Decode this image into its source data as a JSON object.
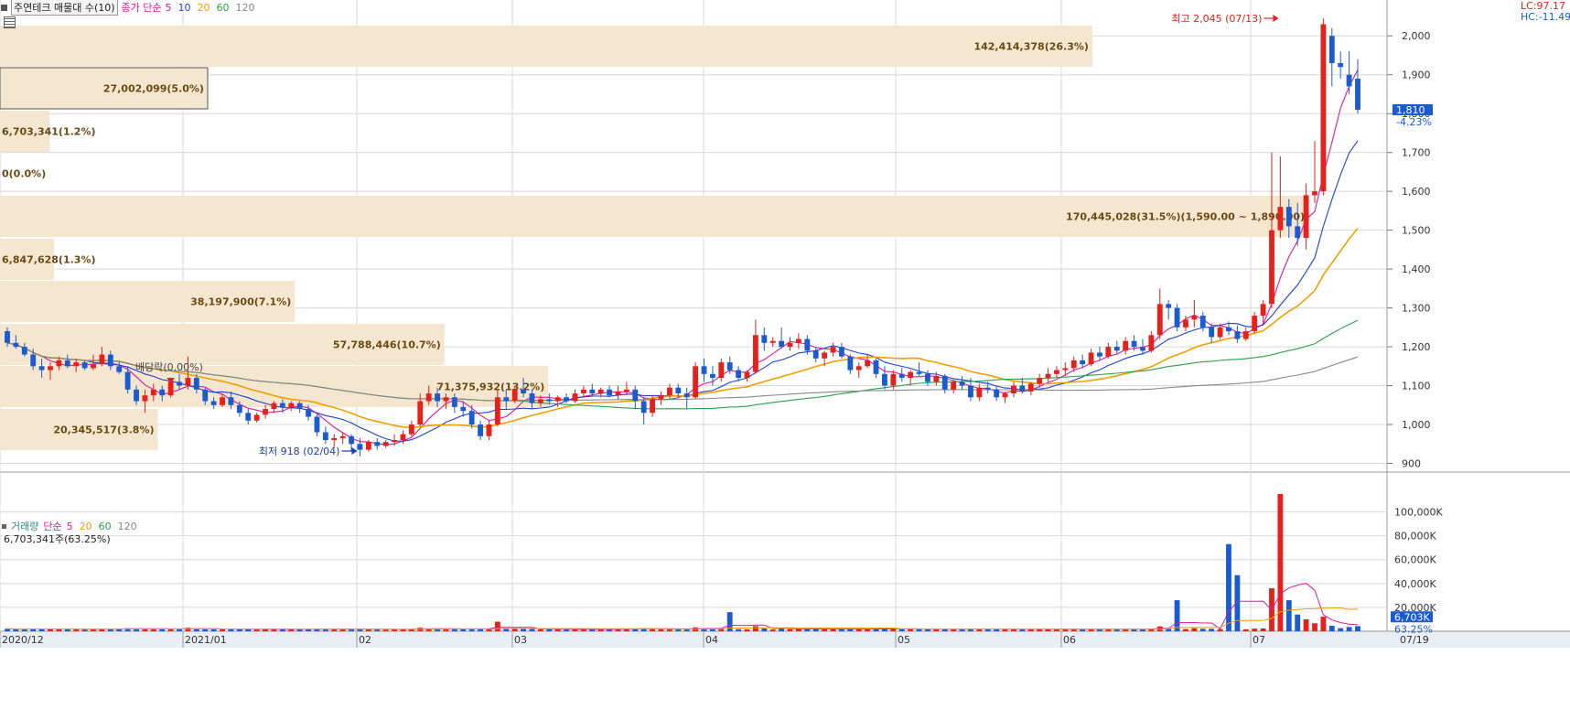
{
  "header": {
    "title": "주연테크 매물대 수(10)",
    "ma_prefix": "종가 단순",
    "ma_periods": [
      {
        "label": "5",
        "color": "#e0199a"
      },
      {
        "label": "10",
        "color": "#1f3fd1"
      },
      {
        "label": "20",
        "color": "#f0a000"
      },
      {
        "label": "60",
        "color": "#2aa04a"
      },
      {
        "label": "120",
        "color": "#888888"
      }
    ],
    "lc_text": "LC:97.17",
    "hc_text": "HC:-11.49"
  },
  "volume_header": {
    "title": "거래량",
    "ma_prefix": "단순",
    "ma_periods": [
      {
        "label": "5",
        "color": "#e0199a"
      },
      {
        "label": "20",
        "color": "#f0a000"
      },
      {
        "label": "60",
        "color": "#2aa04a"
      },
      {
        "label": "120",
        "color": "#888888"
      }
    ],
    "current_text": "6,703,341주(63.25%)"
  },
  "annotations": {
    "high": "최고 2,045 (07/13)",
    "low": "최저 918 (02/04)",
    "dividend": "배당락(0.00%)",
    "current_price": "1,810",
    "current_change": "-4.23%",
    "current_volume": "6,703K",
    "current_volume_pct": "63.25%"
  },
  "colors": {
    "up": "#e8201c",
    "down": "#1a5bd1",
    "band": "#f5e6d0",
    "grid": "#d8d8d8"
  },
  "chart_data": [
    {
      "type": "candlestick",
      "title": "주연테크",
      "y_axis_ticks": [
        900,
        1000,
        1100,
        1200,
        1300,
        1400,
        1500,
        1600,
        1700,
        1800,
        1900,
        2000
      ],
      "ylim": [
        880,
        2050
      ],
      "x_tick_labels": [
        "2020/12",
        "2021/01",
        "02",
        "03",
        "04",
        "05",
        "06",
        "07",
        "07/19"
      ],
      "high": {
        "value": 2045,
        "date": "07/13"
      },
      "low": {
        "value": 918,
        "date": "02/04"
      },
      "last_close": 1810,
      "last_change_pct": -4.23,
      "ohlc": [
        [
          1240,
          1250,
          1200,
          1210
        ],
        [
          1210,
          1230,
          1195,
          1200
        ],
        [
          1200,
          1210,
          1175,
          1180
        ],
        [
          1180,
          1195,
          1140,
          1150
        ],
        [
          1150,
          1170,
          1120,
          1140
        ],
        [
          1140,
          1160,
          1115,
          1150
        ],
        [
          1150,
          1175,
          1140,
          1165
        ],
        [
          1165,
          1180,
          1145,
          1150
        ],
        [
          1150,
          1170,
          1135,
          1160
        ],
        [
          1160,
          1165,
          1140,
          1145
        ],
        [
          1145,
          1180,
          1140,
          1155
        ],
        [
          1155,
          1200,
          1150,
          1180
        ],
        [
          1180,
          1190,
          1140,
          1150
        ],
        [
          1150,
          1160,
          1130,
          1135
        ],
        [
          1135,
          1150,
          1080,
          1090
        ],
        [
          1090,
          1100,
          1050,
          1060
        ],
        [
          1060,
          1090,
          1030,
          1075
        ],
        [
          1075,
          1105,
          1060,
          1090
        ],
        [
          1090,
          1100,
          1060,
          1075
        ],
        [
          1075,
          1120,
          1070,
          1110
        ],
        [
          1110,
          1130,
          1090,
          1100
        ],
        [
          1100,
          1175,
          1090,
          1120
        ],
        [
          1120,
          1130,
          1080,
          1090
        ],
        [
          1090,
          1095,
          1050,
          1060
        ],
        [
          1060,
          1070,
          1040,
          1050
        ],
        [
          1050,
          1080,
          1045,
          1070
        ],
        [
          1070,
          1085,
          1040,
          1050
        ],
        [
          1050,
          1060,
          1020,
          1030
        ],
        [
          1030,
          1040,
          1000,
          1010
        ],
        [
          1010,
          1030,
          1005,
          1025
        ],
        [
          1025,
          1050,
          1015,
          1040
        ],
        [
          1040,
          1060,
          1030,
          1055
        ],
        [
          1055,
          1065,
          1030,
          1045
        ],
        [
          1045,
          1060,
          1035,
          1055
        ],
        [
          1055,
          1060,
          1030,
          1040
        ],
        [
          1040,
          1050,
          1010,
          1020
        ],
        [
          1020,
          1025,
          970,
          980
        ],
        [
          980,
          995,
          950,
          960
        ],
        [
          960,
          975,
          940,
          965
        ],
        [
          965,
          980,
          950,
          970
        ],
        [
          970,
          975,
          930,
          950
        ],
        [
          950,
          965,
          918,
          935
        ],
        [
          935,
          960,
          930,
          955
        ],
        [
          955,
          965,
          935,
          945
        ],
        [
          945,
          960,
          940,
          955
        ],
        [
          955,
          975,
          945,
          960
        ],
        [
          960,
          985,
          950,
          975
        ],
        [
          975,
          1010,
          970,
          1000
        ],
        [
          1000,
          1080,
          995,
          1060
        ],
        [
          1060,
          1100,
          1050,
          1080
        ],
        [
          1080,
          1095,
          1045,
          1060
        ],
        [
          1060,
          1080,
          1040,
          1070
        ],
        [
          1070,
          1080,
          1030,
          1045
        ],
        [
          1045,
          1060,
          1020,
          1035
        ],
        [
          1035,
          1050,
          990,
          1000
        ],
        [
          1000,
          1010,
          960,
          970
        ],
        [
          970,
          1010,
          960,
          1000
        ],
        [
          1000,
          1090,
          995,
          1070
        ],
        [
          1070,
          1090,
          1040,
          1060
        ],
        [
          1060,
          1100,
          1055,
          1090
        ],
        [
          1090,
          1120,
          1070,
          1080
        ],
        [
          1080,
          1090,
          1040,
          1055
        ],
        [
          1055,
          1075,
          1045,
          1065
        ],
        [
          1065,
          1080,
          1050,
          1060
        ],
        [
          1060,
          1075,
          1045,
          1070
        ],
        [
          1070,
          1080,
          1055,
          1060
        ],
        [
          1060,
          1090,
          1055,
          1080
        ],
        [
          1080,
          1100,
          1070,
          1090
        ],
        [
          1090,
          1105,
          1075,
          1080
        ],
        [
          1080,
          1095,
          1070,
          1090
        ],
        [
          1090,
          1100,
          1070,
          1075
        ],
        [
          1075,
          1100,
          1065,
          1085
        ],
        [
          1085,
          1110,
          1075,
          1090
        ],
        [
          1090,
          1100,
          1040,
          1060
        ],
        [
          1060,
          1070,
          1000,
          1030
        ],
        [
          1030,
          1075,
          1020,
          1065
        ],
        [
          1065,
          1085,
          1050,
          1075
        ],
        [
          1075,
          1105,
          1065,
          1095
        ],
        [
          1095,
          1105,
          1070,
          1080
        ],
        [
          1080,
          1095,
          1040,
          1070
        ],
        [
          1070,
          1160,
          1065,
          1150
        ],
        [
          1150,
          1170,
          1110,
          1130
        ],
        [
          1130,
          1150,
          1100,
          1120
        ],
        [
          1120,
          1170,
          1110,
          1160
        ],
        [
          1160,
          1175,
          1130,
          1140
        ],
        [
          1140,
          1150,
          1110,
          1120
        ],
        [
          1120,
          1140,
          1110,
          1135
        ],
        [
          1135,
          1270,
          1130,
          1230
        ],
        [
          1230,
          1250,
          1190,
          1210
        ],
        [
          1210,
          1225,
          1200,
          1215
        ],
        [
          1215,
          1250,
          1195,
          1200
        ],
        [
          1200,
          1225,
          1190,
          1210
        ],
        [
          1210,
          1235,
          1195,
          1220
        ],
        [
          1220,
          1230,
          1180,
          1190
        ],
        [
          1190,
          1200,
          1160,
          1170
        ],
        [
          1170,
          1190,
          1150,
          1185
        ],
        [
          1185,
          1210,
          1175,
          1200
        ],
        [
          1200,
          1210,
          1170,
          1175
        ],
        [
          1175,
          1180,
          1130,
          1140
        ],
        [
          1140,
          1160,
          1120,
          1150
        ],
        [
          1150,
          1180,
          1145,
          1165
        ],
        [
          1165,
          1170,
          1120,
          1130
        ],
        [
          1130,
          1150,
          1090,
          1100
        ],
        [
          1100,
          1140,
          1090,
          1130
        ],
        [
          1130,
          1145,
          1110,
          1120
        ],
        [
          1120,
          1140,
          1100,
          1135
        ],
        [
          1135,
          1160,
          1125,
          1130
        ],
        [
          1130,
          1140,
          1100,
          1110
        ],
        [
          1110,
          1135,
          1100,
          1125
        ],
        [
          1125,
          1130,
          1080,
          1090
        ],
        [
          1090,
          1115,
          1080,
          1110
        ],
        [
          1110,
          1125,
          1090,
          1100
        ],
        [
          1100,
          1120,
          1060,
          1070
        ],
        [
          1070,
          1105,
          1060,
          1095
        ],
        [
          1095,
          1110,
          1080,
          1090
        ],
        [
          1090,
          1100,
          1060,
          1070
        ],
        [
          1070,
          1085,
          1055,
          1080
        ],
        [
          1080,
          1110,
          1070,
          1100
        ],
        [
          1100,
          1120,
          1080,
          1085
        ],
        [
          1085,
          1110,
          1075,
          1105
        ],
        [
          1105,
          1130,
          1095,
          1120
        ],
        [
          1120,
          1145,
          1110,
          1130
        ],
        [
          1130,
          1150,
          1120,
          1140
        ],
        [
          1140,
          1160,
          1125,
          1145
        ],
        [
          1145,
          1175,
          1135,
          1165
        ],
        [
          1165,
          1180,
          1145,
          1155
        ],
        [
          1155,
          1195,
          1150,
          1185
        ],
        [
          1185,
          1200,
          1165,
          1175
        ],
        [
          1175,
          1210,
          1170,
          1200
        ],
        [
          1200,
          1215,
          1180,
          1190
        ],
        [
          1190,
          1225,
          1180,
          1215
        ],
        [
          1215,
          1230,
          1190,
          1200
        ],
        [
          1200,
          1220,
          1180,
          1190
        ],
        [
          1190,
          1240,
          1185,
          1230
        ],
        [
          1230,
          1350,
          1220,
          1310
        ],
        [
          1310,
          1320,
          1270,
          1300
        ],
        [
          1300,
          1310,
          1240,
          1250
        ],
        [
          1250,
          1280,
          1240,
          1270
        ],
        [
          1270,
          1320,
          1250,
          1280
        ],
        [
          1280,
          1290,
          1240,
          1250
        ],
        [
          1250,
          1260,
          1210,
          1225
        ],
        [
          1225,
          1260,
          1220,
          1250
        ],
        [
          1250,
          1265,
          1230,
          1240
        ],
        [
          1240,
          1255,
          1210,
          1220
        ],
        [
          1220,
          1250,
          1215,
          1240
        ],
        [
          1240,
          1290,
          1235,
          1280
        ],
        [
          1280,
          1320,
          1260,
          1310
        ],
        [
          1310,
          1700,
          1300,
          1500
        ],
        [
          1500,
          1690,
          1480,
          1560
        ],
        [
          1560,
          1580,
          1480,
          1510
        ],
        [
          1510,
          1570,
          1460,
          1480
        ],
        [
          1480,
          1620,
          1450,
          1590
        ],
        [
          1590,
          1730,
          1570,
          1600
        ],
        [
          1600,
          2045,
          1590,
          2030
        ],
        [
          2000,
          2020,
          1870,
          1930
        ],
        [
          1930,
          1960,
          1890,
          1920
        ],
        [
          1900,
          1960,
          1850,
          1870
        ],
        [
          1890,
          1940,
          1800,
          1810
        ]
      ]
    },
    {
      "type": "bar",
      "title": "거래량",
      "y_axis_ticks": [
        20000,
        40000,
        60000,
        80000,
        100000
      ],
      "y_tick_labels": [
        "20,000K",
        "40,000K",
        "60,000K",
        "80,000K",
        "100,000K"
      ],
      "ylim": [
        0,
        115000
      ],
      "unit": "K",
      "last_volume": 6703341,
      "last_volume_ratio_pct": 63.25
    },
    {
      "type": "bar",
      "title": "매물대 수(10)",
      "orientation": "horizontal",
      "price_bands": [
        {
          "label": "142,414,378(26.3%)",
          "volume": 142414378,
          "pct": 26.3
        },
        {
          "label": "27,002,099(5.0%)",
          "volume": 27002099,
          "pct": 5.0
        },
        {
          "label": "6,703,341(1.2%)",
          "volume": 6703341,
          "pct": 1.2
        },
        {
          "label": "0(0.0%)",
          "volume": 0,
          "pct": 0.0
        },
        {
          "label": "170,445,028(31.5%)(1,590.00 ~ 1,890.00)",
          "volume": 170445028,
          "pct": 31.5,
          "range": [
            1590,
            1890
          ]
        },
        {
          "label": "6,847,628(1.3%)",
          "volume": 6847628,
          "pct": 1.3
        },
        {
          "label": "38,197,900(7.1%)",
          "volume": 38197900,
          "pct": 7.1
        },
        {
          "label": "57,788,446(10.7%)",
          "volume": 57788446,
          "pct": 10.7
        },
        {
          "label": "71,375,932(13.2%)",
          "volume": 71375932,
          "pct": 13.2
        },
        {
          "label": "20,345,517(3.8%)",
          "volume": 20345517,
          "pct": 3.8
        }
      ]
    }
  ]
}
